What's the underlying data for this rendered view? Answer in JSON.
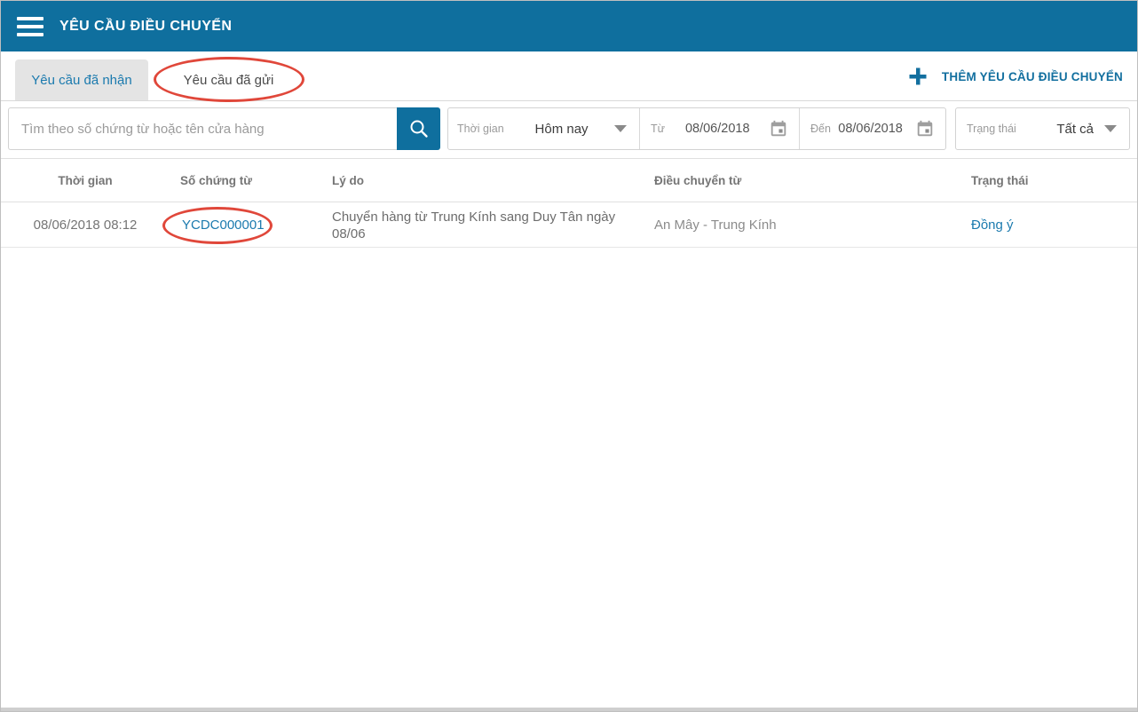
{
  "app": {
    "title": "YÊU CẦU ĐIỀU CHUYỂN"
  },
  "tabs": {
    "received": "Yêu cầu đã nhận",
    "sent": "Yêu cầu đã gửi"
  },
  "actions": {
    "add_label": "THÊM YÊU CẦU ĐIỀU CHUYỂN"
  },
  "filters": {
    "search_placeholder": "Tìm theo số chứng từ hoặc tên cửa hàng",
    "time": {
      "label": "Thời gian",
      "value": "Hôm nay"
    },
    "from": {
      "label": "Từ",
      "value": "08/06/2018"
    },
    "to": {
      "label": "Đến",
      "value": "08/06/2018"
    },
    "status": {
      "label": "Trạng thái",
      "value": "Tất cả"
    }
  },
  "table": {
    "headers": [
      "Thời gian",
      "Số chứng từ",
      "Lý do",
      "Điều chuyển từ",
      "Trạng thái"
    ],
    "rows": [
      {
        "time": "08/06/2018 08:12",
        "code": "YCDC000001",
        "reason": "Chuyển hàng từ Trung Kính sang Duy Tân ngày 08/06",
        "from": "An Mây - Trung Kính",
        "status": "Đồng ý"
      }
    ]
  },
  "icons": {
    "menu": "hamburger",
    "plus": "plus",
    "search": "magnifier",
    "calendar": "calendar",
    "chevron": "triangle-down"
  },
  "colors": {
    "topbar": "#0f6f9e",
    "accent": "#126f9f",
    "link": "#1b7aae",
    "status_agreed": "#1b7aae",
    "annotation_red": "#e0473a",
    "tab_active_bg": "#e4e4e4",
    "border": "#d2d2d2"
  }
}
